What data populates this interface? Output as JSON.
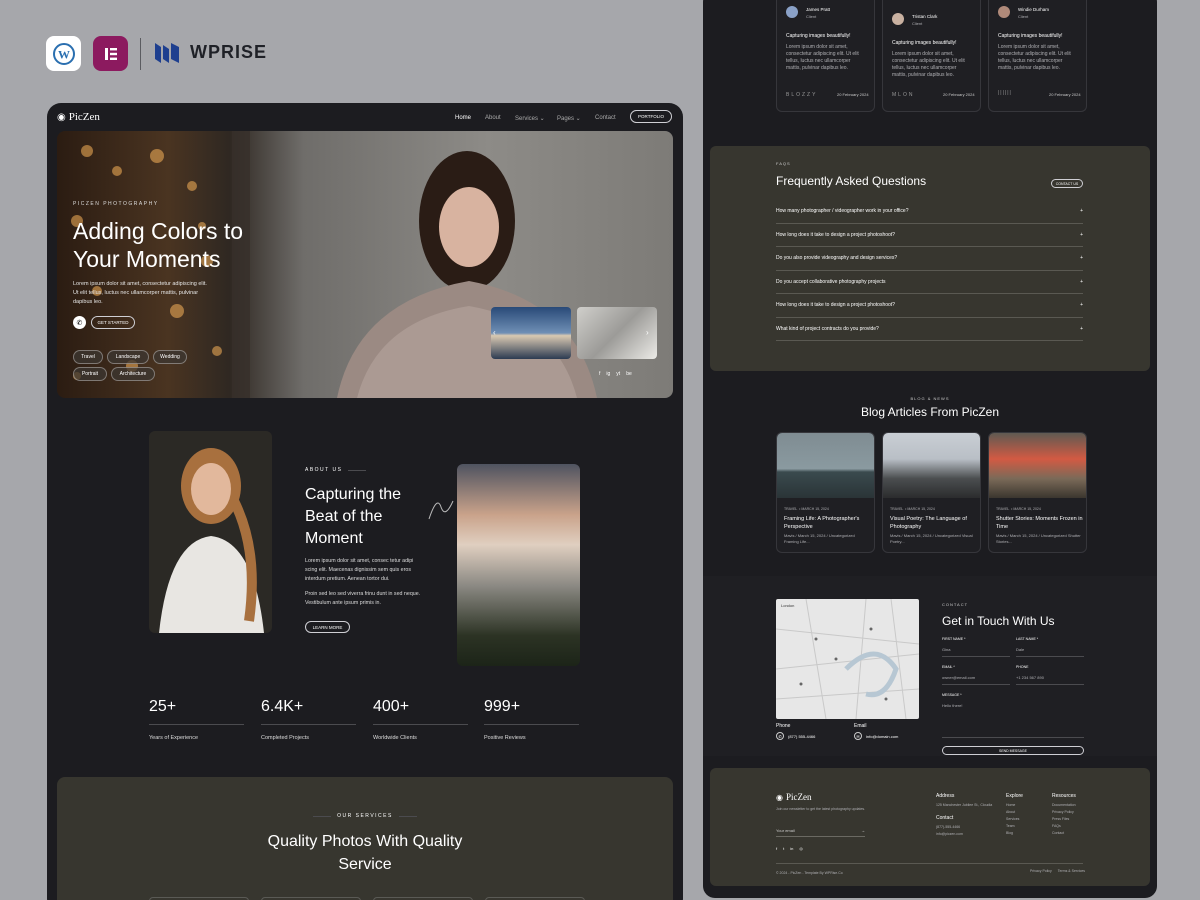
{
  "brand": {
    "name": "WPRISE",
    "wp": "W",
    "el": "E"
  },
  "nav": {
    "logo": "PicZen",
    "items": [
      "Home",
      "About",
      "Services",
      "Pages",
      "Contact"
    ],
    "cta": "PORTFOLIO"
  },
  "hero": {
    "eyebrow": "PICZEN PHOTOGRAPHY",
    "title": "Adding Colors to Your Moments",
    "desc": "Lorem ipsum dolor sit amet, consectetur adipiscing elit. Ut elit tellus, luctus nec ullamcorper mattis, pulvinar dapibus leo.",
    "cta": "GET STARTED",
    "tags": [
      "Travel",
      "Landscape",
      "Wedding",
      "Portrait",
      "Architecture"
    ],
    "social": [
      "f",
      "ig",
      "yt",
      "be"
    ]
  },
  "about": {
    "eyebrow": "ABOUT US",
    "title": "Capturing the Beat of the Moment",
    "p1": "Lorem ipsum dolor sit amet, consec tetur adipi scing elit. Maecenas dignissim sem quis eros interdum pretium. Aenean tortor dui.",
    "p2": "Proin sed leo sed viverra frinu dunt in sed neque. Vestibulum ante ipsum primis in.",
    "cta": "LEARN MORE"
  },
  "stats": [
    {
      "value": "25+",
      "label": "Years of Experience"
    },
    {
      "value": "6.4K+",
      "label": "Completed Projects"
    },
    {
      "value": "400+",
      "label": "Worldwide Clients"
    },
    {
      "value": "999+",
      "label": "Positive Reviews"
    }
  ],
  "services": {
    "eyebrow": "OUR SERVICES",
    "title": "Quality Photos With Quality Service"
  },
  "testimonials": [
    {
      "name": "James Pratt",
      "role": "Client",
      "title": "Capturing images beautifully!",
      "text": "Lorem ipsum dolor sit amet, consectetur adipiscing elit. Ut elit tellus, luctus nec ullamcorper mattis, pulvinar dapibus leo.",
      "brand": "BLOZZY",
      "date": "20 February 2024"
    },
    {
      "name": "Tristan Clark",
      "role": "Client",
      "title": "Capturing images beautifully!",
      "text": "Lorem ipsum dolor sit amet, consectetur adipiscing elit. Ut elit tellus, luctus nec ullamcorper mattis, pulvinar dapibus leo.",
      "brand": "MLON",
      "date": "20 February 2024"
    },
    {
      "name": "Windie Durham",
      "role": "Client",
      "title": "Capturing images beautifully!",
      "text": "Lorem ipsum dolor sit amet, consectetur adipiscing elit. Ut elit tellus, luctus nec ullamcorper mattis, pulvinar dapibus leo.",
      "brand": "||||||",
      "date": "20 February 2024"
    }
  ],
  "faq": {
    "eyebrow": "FAQS",
    "title": "Frequently Asked Questions",
    "cta": "CONTACT US",
    "items": [
      "How many photographer / videographer work in your office?",
      "How long does it take to design a project photoshoot?",
      "Do you also provide videography and design services?",
      "Do you accept collaborative photography projects",
      "How long does it take to design a project photoshoot?",
      "What kind of project contracts do you provide?"
    ]
  },
  "blog": {
    "eyebrow": "BLOG & NEWS",
    "title": "Blog Articles From PicZen",
    "posts": [
      {
        "tag": "TRAVEL",
        "date": "MARCH 15, 2024",
        "title": "Framing Life: A Photographer's Perspective",
        "meta": "Mavis / March 15, 2024 / Uncategorized Framing Life..."
      },
      {
        "tag": "TRAVEL",
        "date": "MARCH 15, 2024",
        "title": "Visual Poetry: The Language of Photography",
        "meta": "Mavis / March 15, 2024 / Uncategorized Visual Poetry..."
      },
      {
        "tag": "TRAVEL",
        "date": "MARCH 15, 2024",
        "title": "Shutter Stories: Moments Frozen in Time",
        "meta": "Mavis / March 15, 2024 / Uncategorized Shutter Stories..."
      }
    ]
  },
  "contact": {
    "eyebrow": "CONTACT",
    "title": "Get in Touch With Us",
    "map_label": "London",
    "phone_label": "Phone",
    "phone": "(877) 555-4466",
    "email_label": "Email",
    "email": "info@domain.com",
    "fields": {
      "first_label": "FIRST NAME *",
      "first": "Gina",
      "last_label": "LAST NAME *",
      "last": "Dale",
      "email_label": "EMAIL *",
      "email": "owner@email.com",
      "phone_label": "PHONE",
      "phone": "+1 234 567 890",
      "message_label": "MESSAGE *",
      "message": "Hello there!"
    },
    "submit": "SEND MESSAGE"
  },
  "footer": {
    "logo": "PicZen",
    "desc": "Join our newsletter to get the latest photography updates.",
    "newsletter_placeholder": "Your email",
    "address_title": "Address",
    "address": "125 Manchester Jubilee St., Cloudia",
    "contact_title": "Contact",
    "phone": "(877)-555-4466",
    "email": "info@piczen.com",
    "explore_title": "Explore",
    "explore": [
      "Home",
      "About",
      "Services",
      "Team",
      "Blog"
    ],
    "resources_title": "Resources",
    "resources": [
      "Documentation",
      "Privacy Policy",
      "Press Files",
      "FAQs",
      "Contact"
    ],
    "copyright": "© 2024 - PicZen - Template By WPRise.Co",
    "legal": [
      "Privacy Policy",
      "Terms & Services"
    ]
  }
}
